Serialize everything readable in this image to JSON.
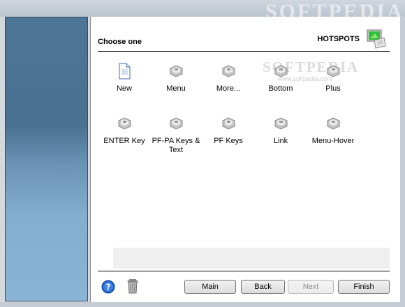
{
  "watermark": {
    "text": "SOFTPEDIA",
    "sub": "www.softpedia.com"
  },
  "header": {
    "title": "Choose one",
    "section_label": "HOTSPOTS",
    "section_icon": "hotspot-monitor-icon"
  },
  "items": [
    {
      "label": "New",
      "icon": "new-document-icon"
    },
    {
      "label": "Menu",
      "icon": "key-icon"
    },
    {
      "label": "More...",
      "icon": "key-icon"
    },
    {
      "label": "Bottom",
      "icon": "key-icon"
    },
    {
      "label": "Plus",
      "icon": "key-icon"
    },
    {
      "label": "ENTER Key",
      "icon": "key-icon"
    },
    {
      "label": "PF-PA Keys & Text",
      "icon": "key-icon"
    },
    {
      "label": "PF Keys",
      "icon": "key-icon"
    },
    {
      "label": "Link",
      "icon": "key-icon"
    },
    {
      "label": "Menu-Hover",
      "icon": "key-icon"
    }
  ],
  "footer": {
    "help_icon": "help-icon",
    "trash_icon": "trash-icon",
    "buttons": {
      "main": "Main",
      "back": "Back",
      "next": "Next",
      "finish": "Finish"
    }
  },
  "colors": {
    "sidebar_top": "#4e7596",
    "sidebar_bottom": "#89b4d6",
    "accent_help": "#1f62c8"
  }
}
